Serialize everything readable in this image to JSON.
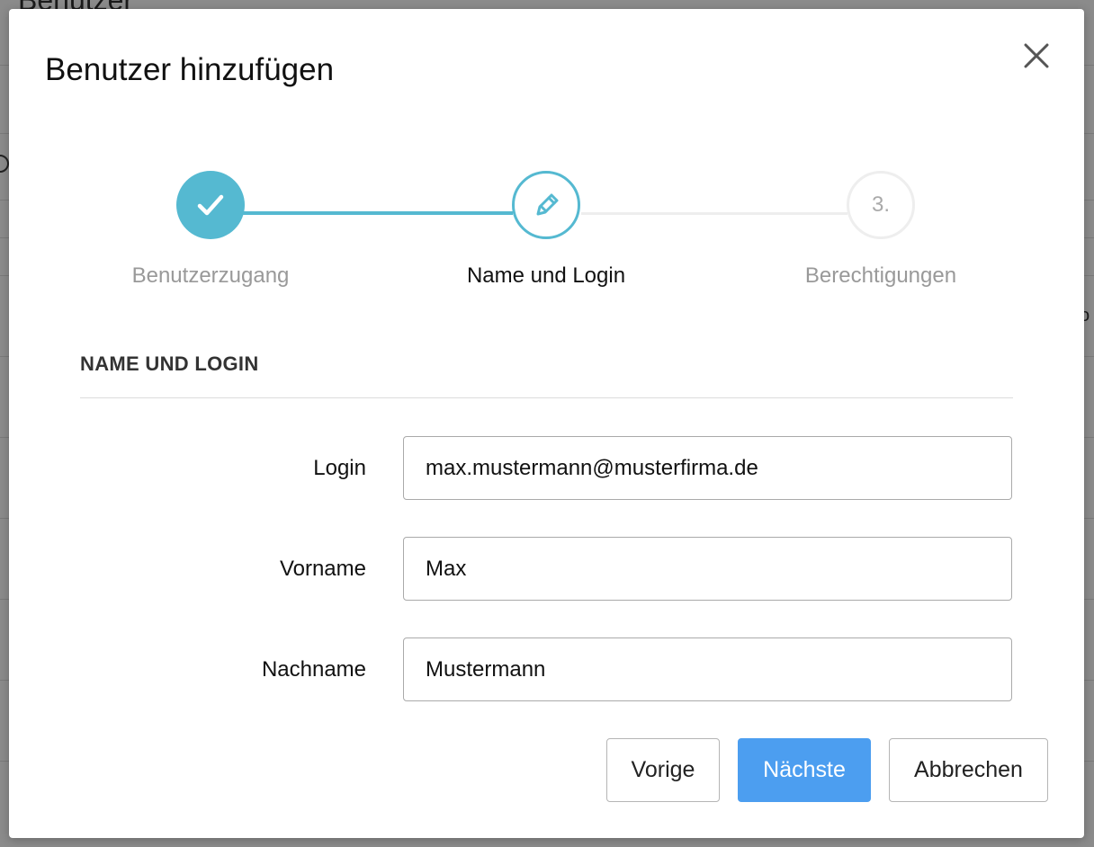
{
  "background": {
    "page_title": "Benutzer",
    "right_fragment": "o"
  },
  "modal": {
    "title": "Benutzer hinzufügen"
  },
  "stepper": {
    "steps": [
      {
        "label": "Benutzerzugang",
        "state": "done",
        "icon": "check-icon"
      },
      {
        "label": "Name und Login",
        "state": "active",
        "icon": "pencil-icon"
      },
      {
        "label": "Berechtigungen",
        "state": "todo",
        "number": "3."
      }
    ],
    "accent_color": "#55b9d1"
  },
  "section": {
    "heading": "NAME UND LOGIN"
  },
  "form": {
    "login": {
      "label": "Login",
      "value": "max.mustermann@musterfirma.de"
    },
    "vorname": {
      "label": "Vorname",
      "value": "Max"
    },
    "nachname": {
      "label": "Nachname",
      "value": "Mustermann"
    }
  },
  "buttons": {
    "prev": "Vorige",
    "next": "Nächste",
    "cancel": "Abbrechen"
  },
  "colors": {
    "primary": "#4c9ef0"
  }
}
